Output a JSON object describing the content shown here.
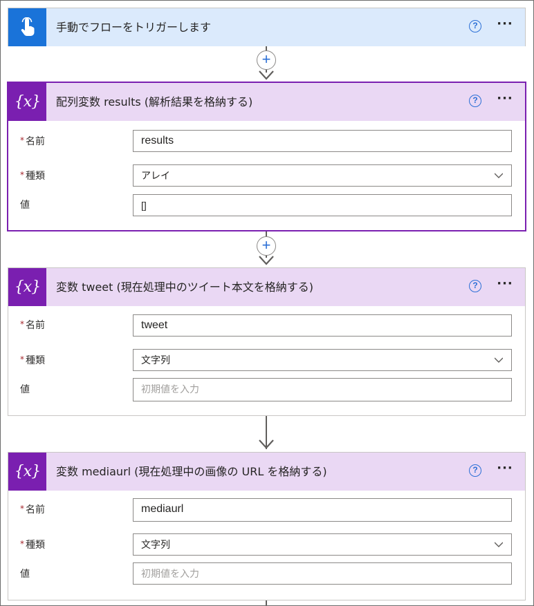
{
  "trigger": {
    "title": "手動でフローをトリガーします",
    "help_symbol": "?",
    "more_symbol": "···"
  },
  "steps": [
    {
      "title": "配列変数 results (解析結果を格納する)",
      "fields": {
        "name_label": "名前",
        "name_value": "results",
        "type_label": "種類",
        "type_value": "アレイ",
        "value_label": "値",
        "value_value": "[]"
      }
    },
    {
      "title": "変数 tweet (現在処理中のツイート本文を格納する)",
      "fields": {
        "name_label": "名前",
        "name_value": "tweet",
        "type_label": "種類",
        "type_value": "文字列",
        "value_label": "値",
        "value_placeholder": "初期値を入力"
      }
    },
    {
      "title": "変数 mediaurl (現在処理中の画像の URL を格納する)",
      "fields": {
        "name_label": "名前",
        "name_value": "mediaurl",
        "type_label": "種類",
        "type_value": "文字列",
        "value_label": "値",
        "value_placeholder": "初期値を入力"
      }
    }
  ],
  "common": {
    "required_marker": "*",
    "help_symbol": "?",
    "more_symbol": "···",
    "add_symbol": "+",
    "var_icon_text": "{x}"
  },
  "colors": {
    "trigger_header": "#dbeafc",
    "trigger_icon": "#1a73d9",
    "variable_header": "#ead8f4",
    "variable_icon": "#7a1fb0",
    "selected_border": "#7a1fb0",
    "help_accent": "#2b6fd6",
    "required": "#a4262c"
  }
}
